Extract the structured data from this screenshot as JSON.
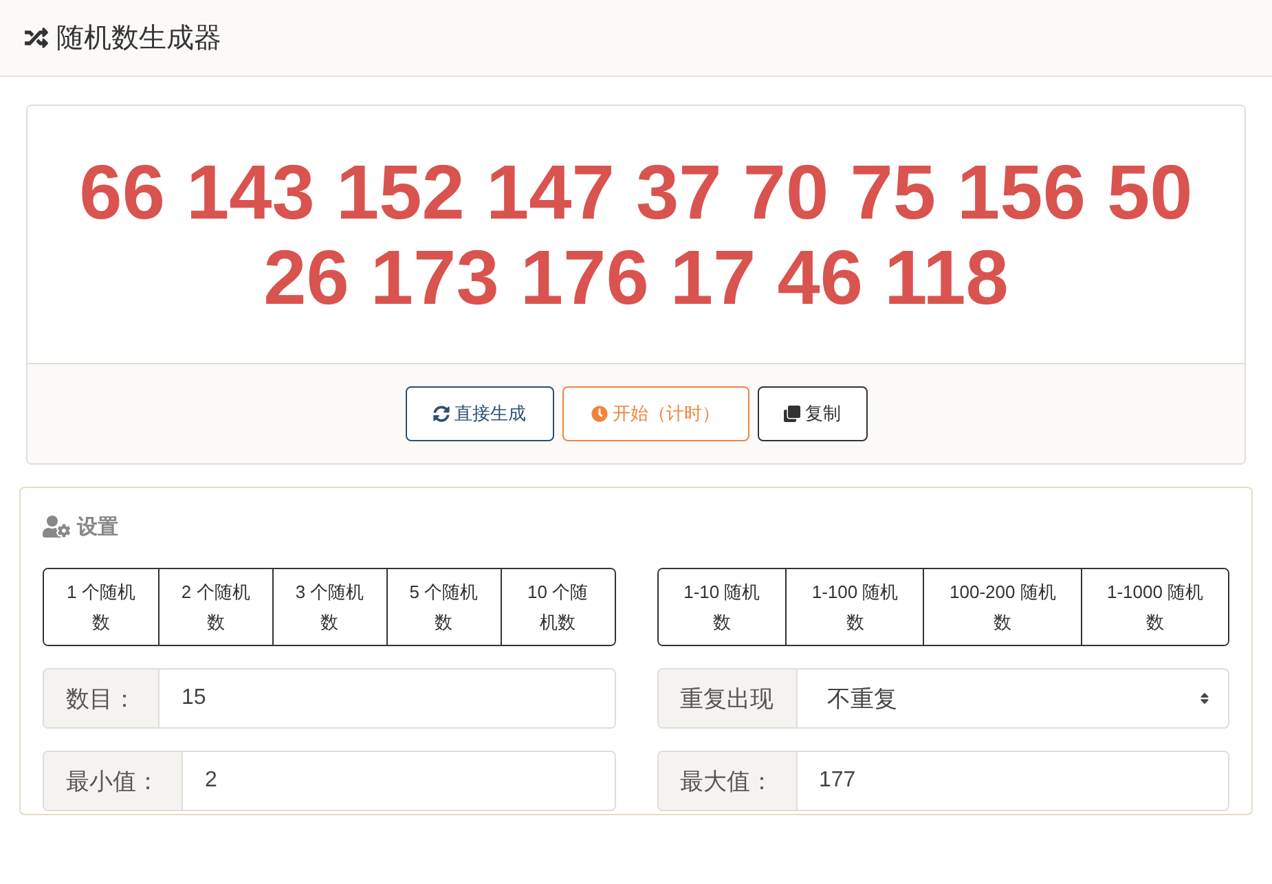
{
  "header": {
    "title": "随机数生成器"
  },
  "result": {
    "lines": [
      "66 143 152 147 37 70 75 156 50",
      "26 173 176 17 46 118"
    ]
  },
  "actions": [
    {
      "kind": "generate",
      "label": "直接生成"
    },
    {
      "kind": "timer",
      "label": "开始（计时）"
    },
    {
      "kind": "copy",
      "label": "复制"
    }
  ],
  "settings": {
    "title": "设置",
    "count_presets": [
      "1 个随机数",
      "2 个随机数",
      "3 个随机数",
      "5 个随机数",
      "10 个随机数"
    ],
    "range_presets": [
      "1-10 随机数",
      "1-100 随机数",
      "100-200 随机数",
      "1-1000 随机数"
    ],
    "fields": [
      {
        "kind": "input",
        "label": "数目：",
        "value": "15"
      },
      {
        "kind": "select",
        "label": "重复出现",
        "value": "不重复"
      },
      {
        "kind": "input",
        "label": "最小值：",
        "value": "2"
      },
      {
        "kind": "input",
        "label": "最大值：",
        "value": "177"
      }
    ]
  }
}
